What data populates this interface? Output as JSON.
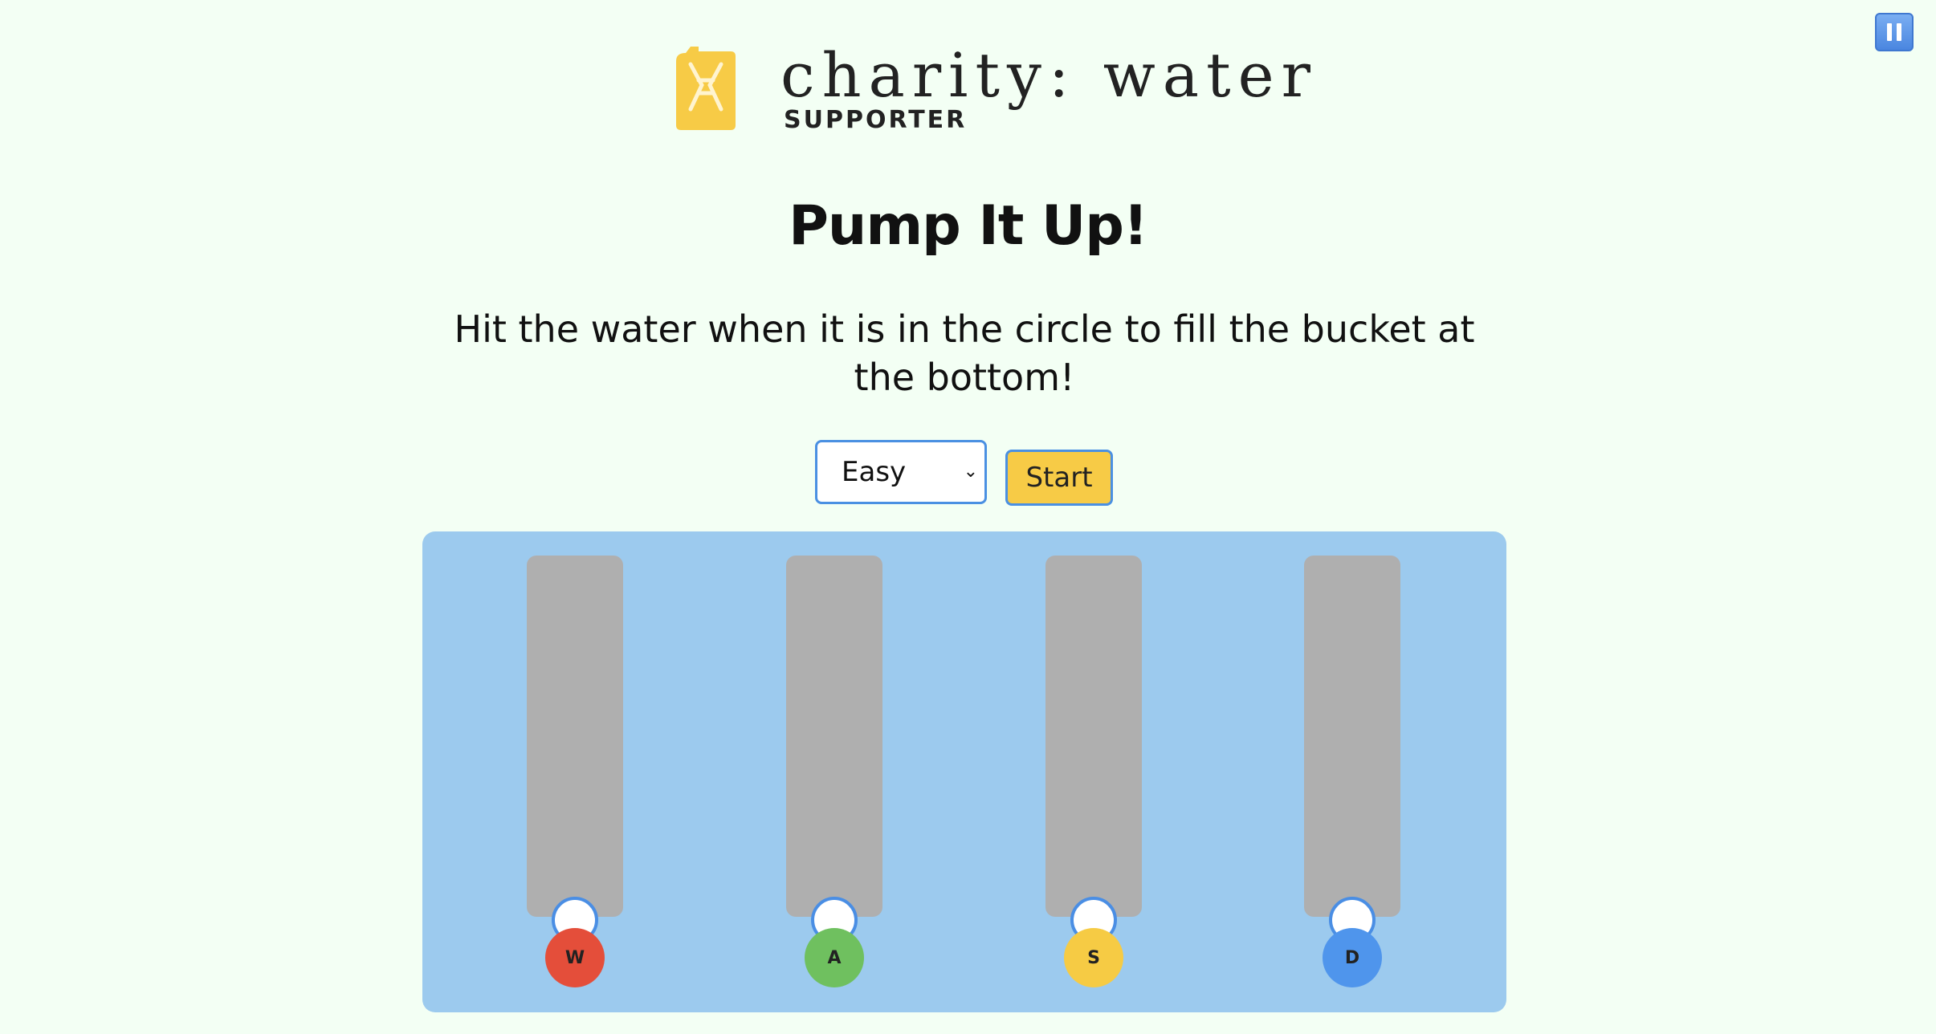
{
  "logo": {
    "wordmark": "charity: water",
    "subtitle": "SUPPORTER",
    "icon": "jerrycan-icon",
    "color": "#f7cb46"
  },
  "page": {
    "title": "Pump It Up!",
    "instructions": "Hit the water when it is in the circle to fill the bucket at the bottom!"
  },
  "controls": {
    "difficulty_selected": "Easy",
    "start_label": "Start",
    "pause_icon": "pause-icon"
  },
  "lanes": [
    {
      "key": "W",
      "color": "#e44e3a"
    },
    {
      "key": "A",
      "color": "#6fc05f"
    },
    {
      "key": "S",
      "color": "#f6cb44"
    },
    {
      "key": "D",
      "color": "#4f95ec"
    }
  ],
  "colors": {
    "background": "#f3fff4",
    "board": "#9ccaee",
    "lane": "#afafaf",
    "accent": "#4a90e2"
  }
}
